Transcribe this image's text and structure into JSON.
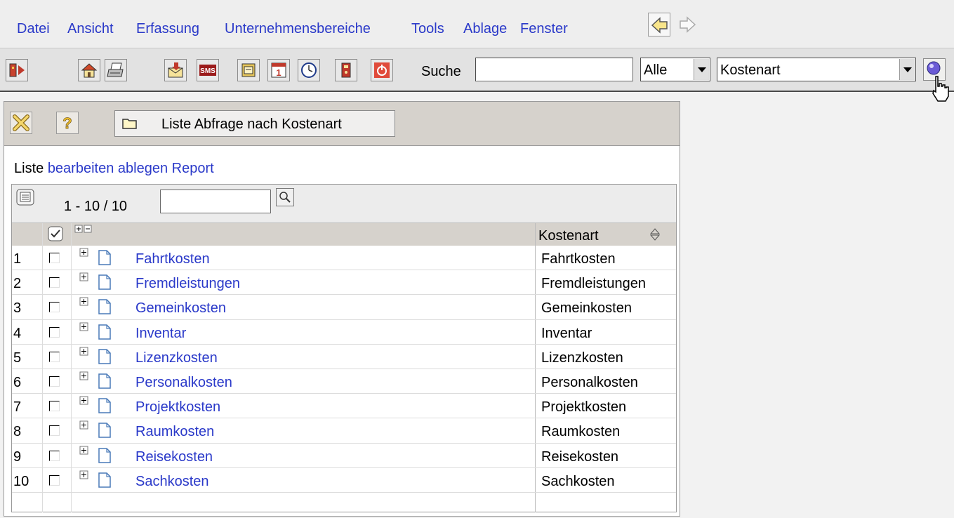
{
  "menu": [
    "Datei",
    "Ansicht",
    "Erfassung",
    "Unternehmensbereiche",
    "Tools",
    "Ablage",
    "Fenster"
  ],
  "toolbar": {
    "search_label": "Suche",
    "search_value": "",
    "scope_select": "Alle",
    "field_select": "Kostenart",
    "icons": [
      "exit-icon",
      "home-icon",
      "print-icon",
      "mail-icon",
      "sms-icon",
      "notes-icon",
      "calendar-icon",
      "clock-icon",
      "binder-icon",
      "power-icon",
      "search-go-icon"
    ]
  },
  "panel": {
    "tab_label": "Liste Abfrage nach Kostenart",
    "actions": {
      "prefix": "Liste",
      "links": [
        "bearbeiten",
        "ablegen",
        "Report"
      ]
    },
    "pager": "1 - 10 / 10",
    "filter_value": "",
    "column_header": "Kostenart",
    "rows": [
      {
        "num": "1",
        "name": "Fahrtkosten",
        "kostenart": "Fahrtkosten"
      },
      {
        "num": "2",
        "name": "Fremdleistungen",
        "kostenart": "Fremdleistungen"
      },
      {
        "num": "3",
        "name": "Gemeinkosten",
        "kostenart": "Gemeinkosten"
      },
      {
        "num": "4",
        "name": "Inventar",
        "kostenart": "Inventar"
      },
      {
        "num": "5",
        "name": "Lizenzkosten",
        "kostenart": "Lizenzkosten"
      },
      {
        "num": "6",
        "name": "Personalkosten",
        "kostenart": "Personalkosten"
      },
      {
        "num": "7",
        "name": "Projektkosten",
        "kostenart": "Projektkosten"
      },
      {
        "num": "8",
        "name": "Raumkosten",
        "kostenart": "Raumkosten"
      },
      {
        "num": "9",
        "name": "Reisekosten",
        "kostenart": "Reisekosten"
      },
      {
        "num": "10",
        "name": "Sachkosten",
        "kostenart": "Sachkosten"
      }
    ]
  },
  "colors": {
    "link": "#2a39c9",
    "header_bg": "#d6d2cc",
    "toolbar_bg": "#e2e2e2"
  }
}
